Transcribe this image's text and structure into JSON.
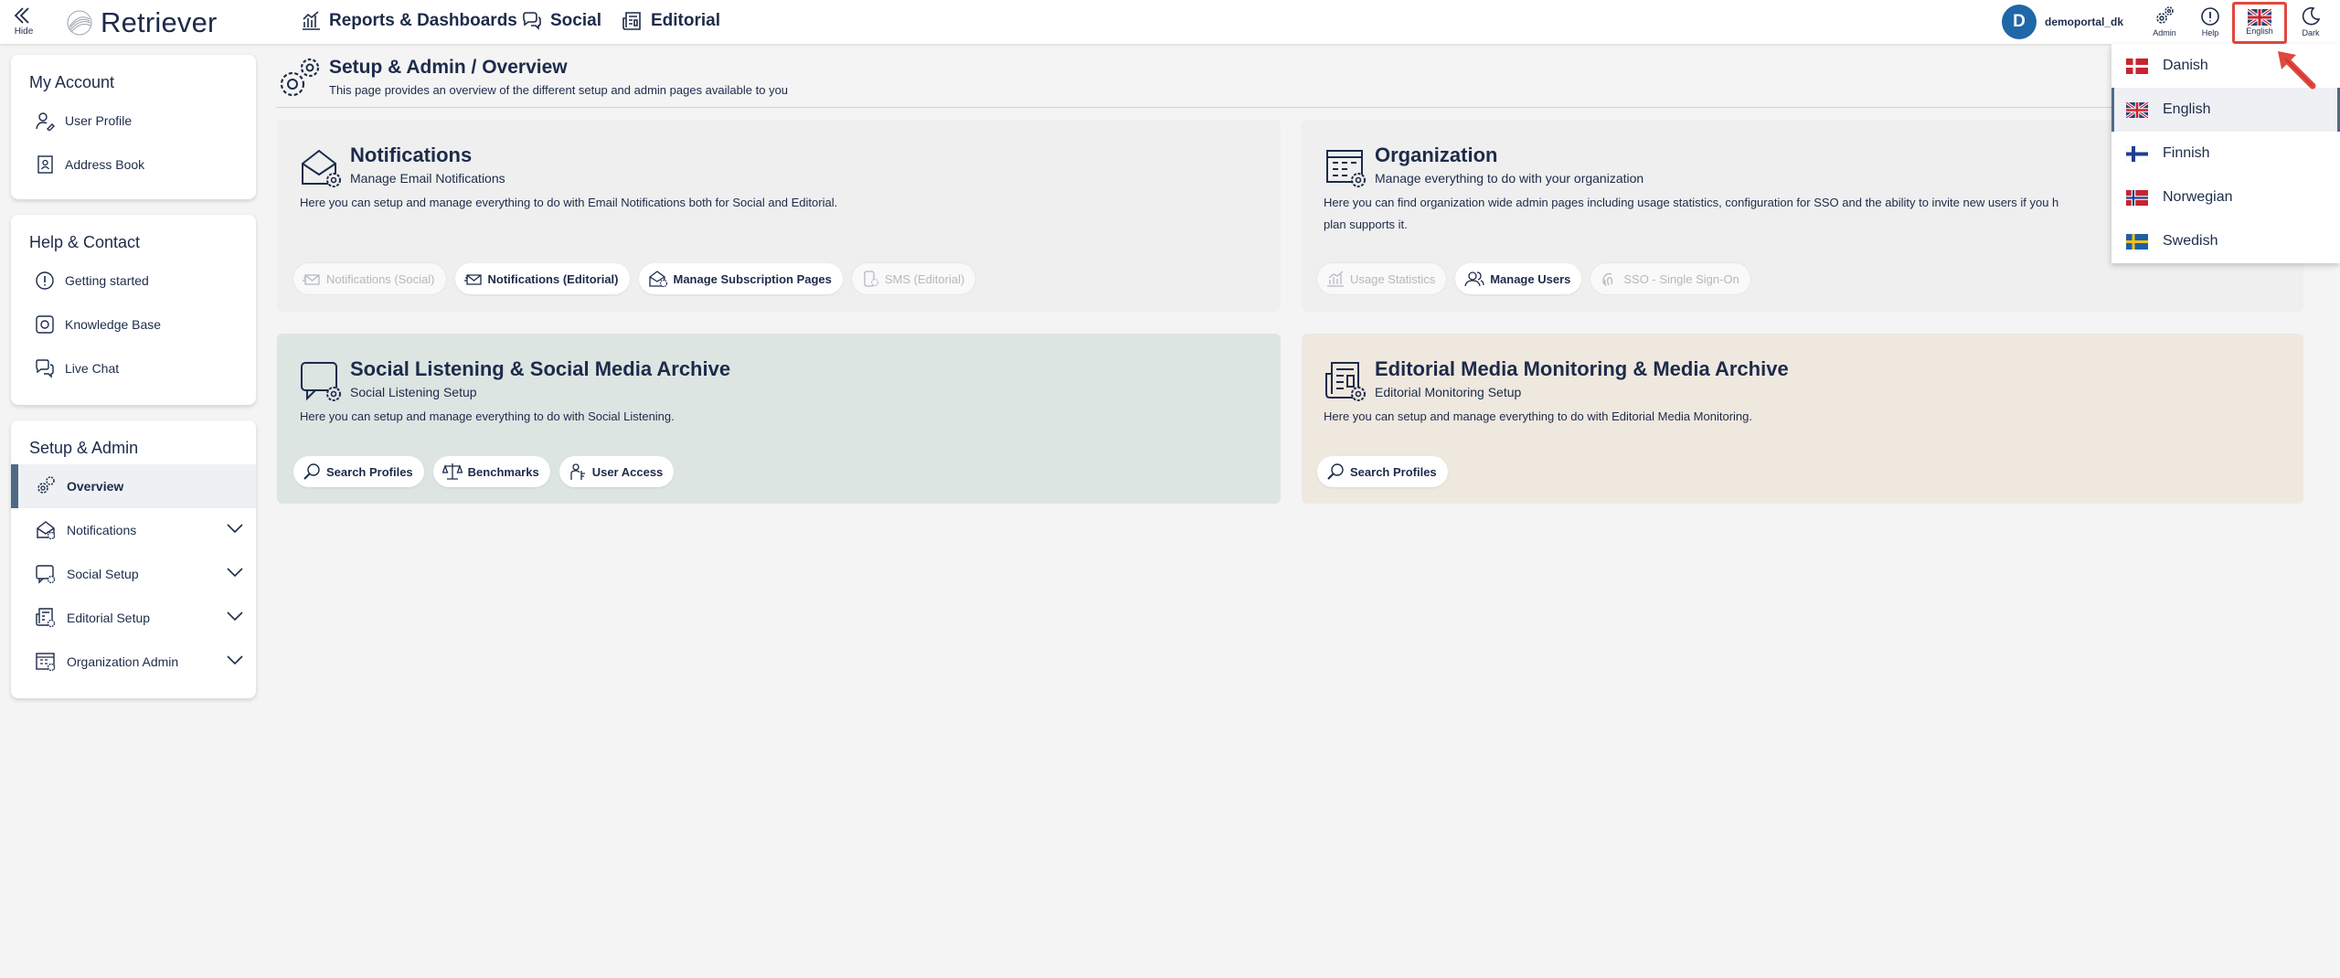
{
  "topbar": {
    "hide_label": "Hide",
    "logo_text": "Retriever",
    "nav": [
      {
        "label": "Reports & Dashboards"
      },
      {
        "label": "Social"
      },
      {
        "label": "Editorial"
      }
    ],
    "user": {
      "initial": "D",
      "name": "demoportal_dk"
    },
    "tools": {
      "admin": "Admin",
      "help": "Help",
      "language": "English",
      "dark": "Dark"
    }
  },
  "sidebar": {
    "my_account": {
      "title": "My Account",
      "items": [
        {
          "label": "User Profile"
        },
        {
          "label": "Address Book"
        }
      ]
    },
    "help_contact": {
      "title": "Help & Contact",
      "items": [
        {
          "label": "Getting started"
        },
        {
          "label": "Knowledge Base"
        },
        {
          "label": "Live Chat"
        }
      ]
    },
    "setup_admin": {
      "title": "Setup & Admin",
      "items": [
        {
          "label": "Overview"
        },
        {
          "label": "Notifications"
        },
        {
          "label": "Social Setup"
        },
        {
          "label": "Editorial Setup"
        },
        {
          "label": "Organization Admin"
        }
      ]
    }
  },
  "main": {
    "title": "Setup & Admin / Overview",
    "subtitle": "This page provides an overview of the different setup and admin pages available to you",
    "cards": {
      "notifications": {
        "title": "Notifications",
        "subtitle": "Manage Email Notifications",
        "description": "Here you can setup and manage everything to do with Email Notifications both for Social and Editorial.",
        "chips": [
          "Notifications (Social)",
          "Notifications (Editorial)",
          "Manage Subscription Pages",
          "SMS (Editorial)"
        ]
      },
      "organization": {
        "title": "Organization",
        "subtitle": "Manage everything to do with your organization",
        "description_line1": "Here you can find organization wide admin pages including usage statistics, configuration for SSO and the ability to invite new users if you h",
        "description_line2": "plan supports it.",
        "chips": [
          "Usage Statistics",
          "Manage Users",
          "SSO - Single Sign-On"
        ]
      },
      "social": {
        "title": "Social Listening & Social Media Archive",
        "subtitle": "Social Listening Setup",
        "description": "Here you can setup and manage everything to do with Social Listening.",
        "chips": [
          "Search Profiles",
          "Benchmarks",
          "User Access"
        ]
      },
      "editorial": {
        "title": "Editorial Media Monitoring & Media Archive",
        "subtitle": "Editorial Monitoring Setup",
        "description": "Here you can setup and manage everything to do with Editorial Media Monitoring.",
        "chips": [
          "Search Profiles"
        ]
      }
    }
  },
  "language_dropdown": {
    "options": [
      {
        "label": "Danish"
      },
      {
        "label": "English"
      },
      {
        "label": "Finnish"
      },
      {
        "label": "Norwegian"
      },
      {
        "label": "Swedish"
      }
    ],
    "selected": "English"
  },
  "colors": {
    "navy": "#1d2b4a",
    "social_card_bg": "#dde5e3",
    "editorial_card_bg": "#efe8df",
    "neutral_card_bg": "#efefef",
    "highlight_red": "#e0483e"
  }
}
